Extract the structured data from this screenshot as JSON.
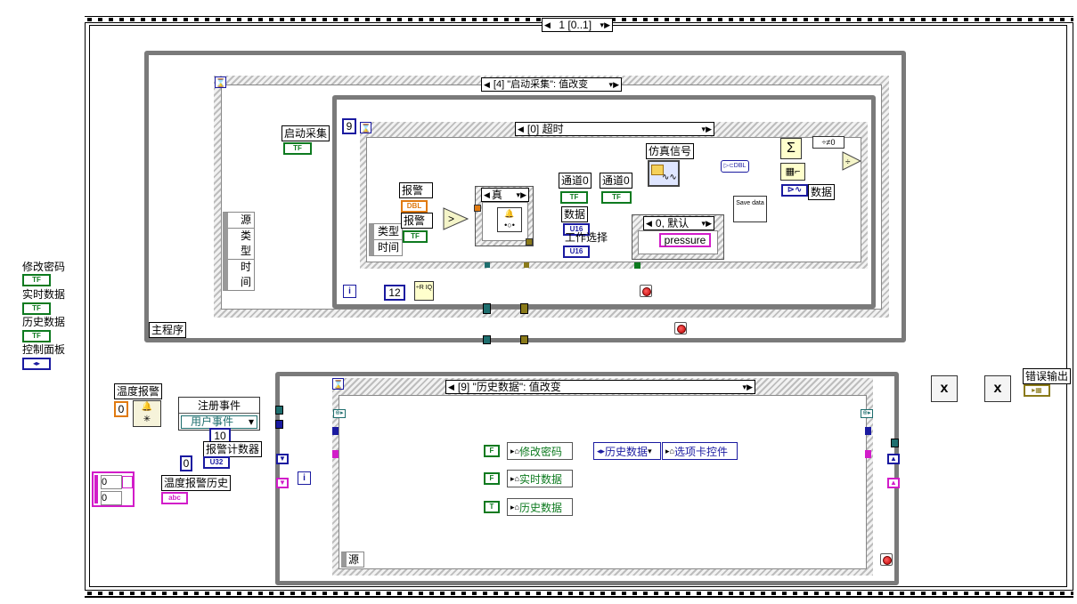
{
  "front_panel_legend": {
    "items": [
      {
        "label": "修改密码",
        "term": "TF"
      },
      {
        "label": "实时数据",
        "term": "TF"
      },
      {
        "label": "历史数据",
        "term": "TF"
      },
      {
        "label": "控制面板",
        "term": "◂▸"
      }
    ]
  },
  "top_sequence": {
    "selector": "1 [0..1]"
  },
  "main_program": {
    "label": "主程序",
    "event_selector": "[4] \"启动采集\": 值改变",
    "start_acq_label": "启动采集",
    "start_acq_term": "TF",
    "event_data_cluster": [
      "源",
      "类型",
      "时间"
    ],
    "inner_event_selector": "[0] 超时",
    "timeout_value": "9",
    "timeout_cluster": [
      "类型",
      "时间"
    ],
    "alarm_label_1": "报警",
    "alarm_term_1": "DBL",
    "alarm_label_2": "报警",
    "alarm_term_2": "TF",
    "case_selector": "真",
    "channel0_label_a": "通道0",
    "channel0_label_b": "通道0",
    "channel_term": "TF",
    "data_label": "数据",
    "work_select_label": "工作选择",
    "u16_term": "U16",
    "sub_case_selector": "0, 默认",
    "pressure_text": "pressure",
    "save_data_text": "Save data",
    "sim_signal_label": "仿真信号",
    "data_label_right": "数据",
    "not_equal_zero": "≠0",
    "iteration_i": "i",
    "const_12": "12",
    "quotient_symbol": "R IQ"
  },
  "history_section": {
    "temp_alarm_label": "温度报警",
    "temp_alarm_value": "0",
    "register_events_label": "注册事件",
    "user_event_label": "用户事件",
    "const_10": "10",
    "alarm_counter_label": "报警计数器",
    "counter_value": "0",
    "u32_term": "U32",
    "temp_history_label": "温度报警历史",
    "array_values": [
      "0",
      "0"
    ],
    "abc_term": "abc",
    "event_selector": "[9] \"历史数据\": 值改变",
    "false_const_1": "F",
    "false_const_2": "F",
    "true_const": "T",
    "modify_pw_prop": "修改密码",
    "realtime_prop": "实时数据",
    "history_prop": "历史数据",
    "tab_ring": "历史数据",
    "tab_control_prop": "选项卡控件",
    "source_label": "源",
    "iteration_i": "i"
  },
  "error_output": {
    "label": "错误输出"
  },
  "colors": {
    "boolean": "#0d7a1f",
    "numeric_dbl": "#e07a10",
    "integer": "#1a1aa0",
    "string": "#d21cc9",
    "cluster": "#8a7a1a",
    "refnum": "#1e6e6e",
    "structure": "#7a7a7a"
  }
}
